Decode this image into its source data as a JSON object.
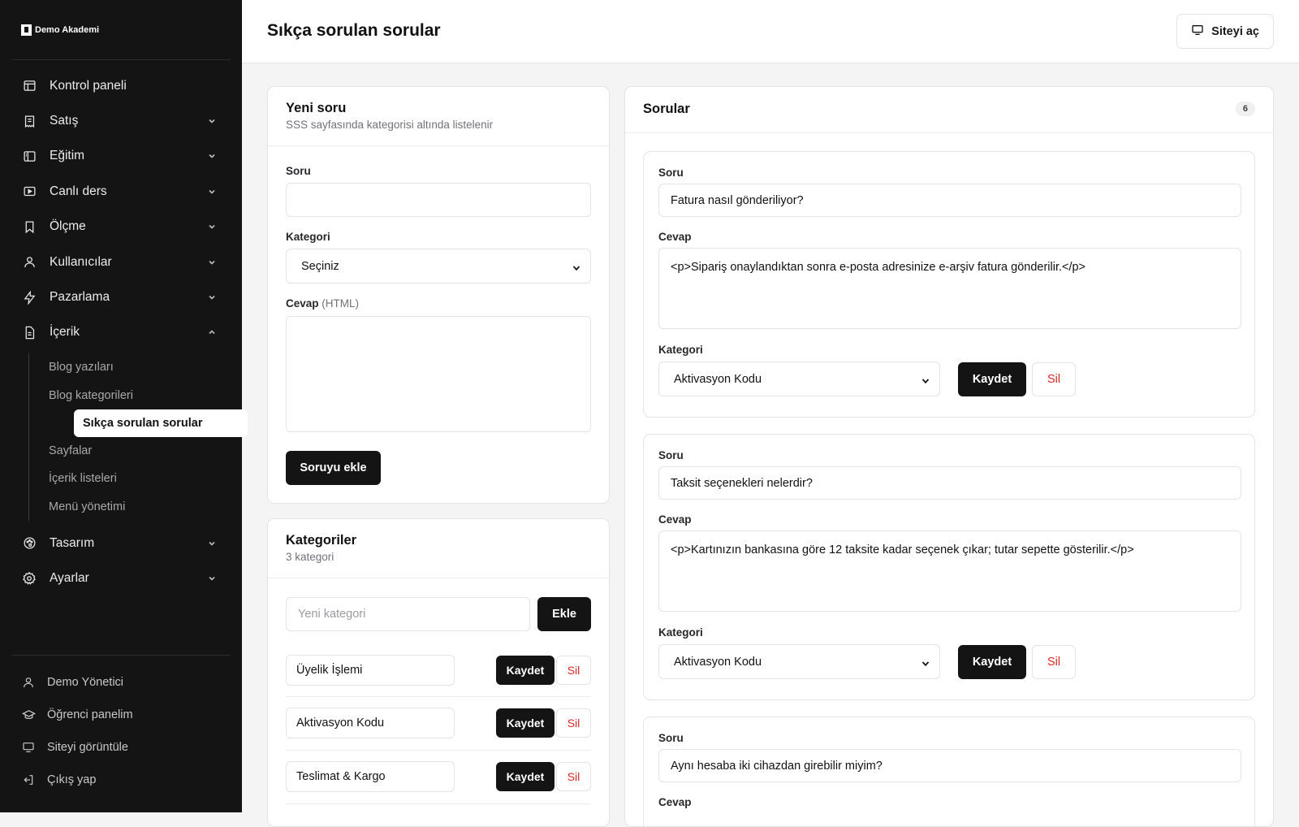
{
  "brand": {
    "name": "Demo Akademi"
  },
  "sidebar": {
    "items": [
      {
        "label": "Kontrol paneli",
        "icon": "layout-icon",
        "chevron": ""
      },
      {
        "label": "Satış",
        "icon": "receipt-icon",
        "chevron": "down"
      },
      {
        "label": "Eğitim",
        "icon": "book-open-icon",
        "chevron": "down"
      },
      {
        "label": "Canlı ders",
        "icon": "video-icon",
        "chevron": "down"
      },
      {
        "label": "Ölçme",
        "icon": "bookmark-icon",
        "chevron": "down"
      },
      {
        "label": "Kullanıcılar",
        "icon": "user-icon",
        "chevron": "down"
      },
      {
        "label": "Pazarlama",
        "icon": "bolt-icon",
        "chevron": "down"
      },
      {
        "label": "İçerik",
        "icon": "file-text-icon",
        "chevron": "up"
      }
    ],
    "content_sub": [
      {
        "label": "Blog yazıları",
        "active": false
      },
      {
        "label": "Blog kategorileri",
        "active": false
      },
      {
        "label": "Sıkça sorulan sorular",
        "active": true
      },
      {
        "label": "Sayfalar",
        "active": false
      },
      {
        "label": "İçerik listeleri",
        "active": false
      },
      {
        "label": "Menü yönetimi",
        "active": false
      }
    ],
    "items_after": [
      {
        "label": "Tasarım",
        "icon": "palette-icon",
        "chevron": "down"
      },
      {
        "label": "Ayarlar",
        "icon": "gear-icon",
        "chevron": "down"
      }
    ],
    "footer": [
      {
        "label": "Demo Yönetici",
        "icon": "user-icon"
      },
      {
        "label": "Öğrenci panelim",
        "icon": "graduation-cap-icon"
      },
      {
        "label": "Siteyi görüntüle",
        "icon": "monitor-icon"
      },
      {
        "label": "Çıkış yap",
        "icon": "logout-icon"
      }
    ]
  },
  "header": {
    "title": "Sıkça sorulan sorular",
    "site_button": "Siteyi aç",
    "site_button_icon": "monitor-icon"
  },
  "new_question": {
    "title": "Yeni soru",
    "subtitle": "SSS sayfasında kategorisi altında listelenir",
    "question_label": "Soru",
    "question_value": "",
    "category_label": "Kategori",
    "category_value": "Seçiniz",
    "answer_label": "Cevap",
    "answer_hint": "(HTML)",
    "answer_value": "",
    "submit_label": "Soruyu ekle"
  },
  "categories": {
    "title": "Kategoriler",
    "subtitle": "3 kategori",
    "new_placeholder": "Yeni kategori",
    "add_label": "Ekle",
    "save_label": "Kaydet",
    "delete_label": "Sil",
    "items": [
      "Üyelik İşlemi",
      "Aktivasyon Kodu",
      "Teslimat & Kargo"
    ]
  },
  "questions": {
    "title": "Sorular",
    "count": "6",
    "question_label": "Soru",
    "answer_label": "Cevap",
    "category_label": "Kategori",
    "save_label": "Kaydet",
    "delete_label": "Sil",
    "items": [
      {
        "question": "Fatura nasıl gönderiliyor?",
        "answer": "<p>Sipariş onaylandıktan sonra e-posta adresinize e-arşiv fatura gönderilir.</p>",
        "category": "Aktivasyon Kodu"
      },
      {
        "question": "Taksit seçenekleri nelerdir?",
        "answer": "<p>Kartınızın bankasına göre 12 taksite kadar seçenek çıkar; tutar sepette gösterilir.</p>",
        "category": "Aktivasyon Kodu"
      },
      {
        "question": "Aynı hesaba iki cihazdan girebilir miyim?"
      }
    ]
  },
  "colors": {
    "sidebar_bg": "#141414",
    "accent_dark": "#141414",
    "danger": "#dc2626",
    "page_bg": "#f4f4f5"
  }
}
